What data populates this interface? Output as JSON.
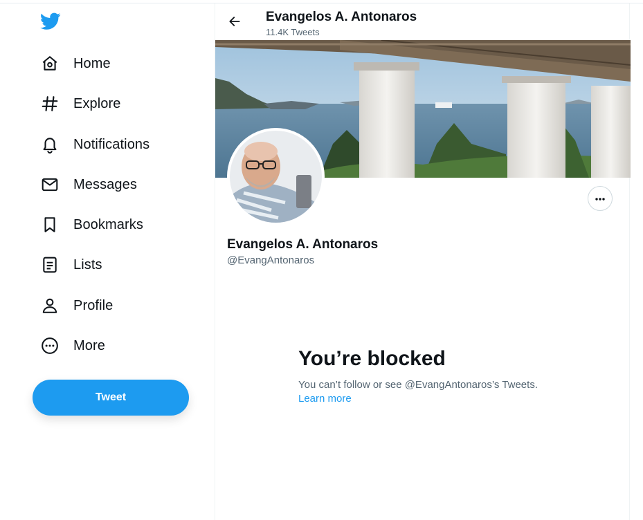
{
  "brand": {
    "accent": "#1d9bf0",
    "logo_icon": "twitter-bird-icon"
  },
  "sidebar": {
    "items": [
      {
        "label": "Home",
        "icon": "home-icon"
      },
      {
        "label": "Explore",
        "icon": "hashtag-icon"
      },
      {
        "label": "Notifications",
        "icon": "bell-icon"
      },
      {
        "label": "Messages",
        "icon": "envelope-icon"
      },
      {
        "label": "Bookmarks",
        "icon": "bookmark-icon"
      },
      {
        "label": "Lists",
        "icon": "list-icon"
      },
      {
        "label": "Profile",
        "icon": "person-icon"
      },
      {
        "label": "More",
        "icon": "more-circle-icon"
      }
    ],
    "tweet_button": "Tweet"
  },
  "header": {
    "title": "Evangelos A. Antonaros",
    "subtitle": "11.4K Tweets"
  },
  "profile": {
    "name": "Evangelos A. Antonaros",
    "handle": "@EvangAntonaros"
  },
  "blocked": {
    "title": "You’re blocked",
    "description": "You can’t follow or see @EvangAntonaros’s Tweets.",
    "link": "Learn more"
  }
}
